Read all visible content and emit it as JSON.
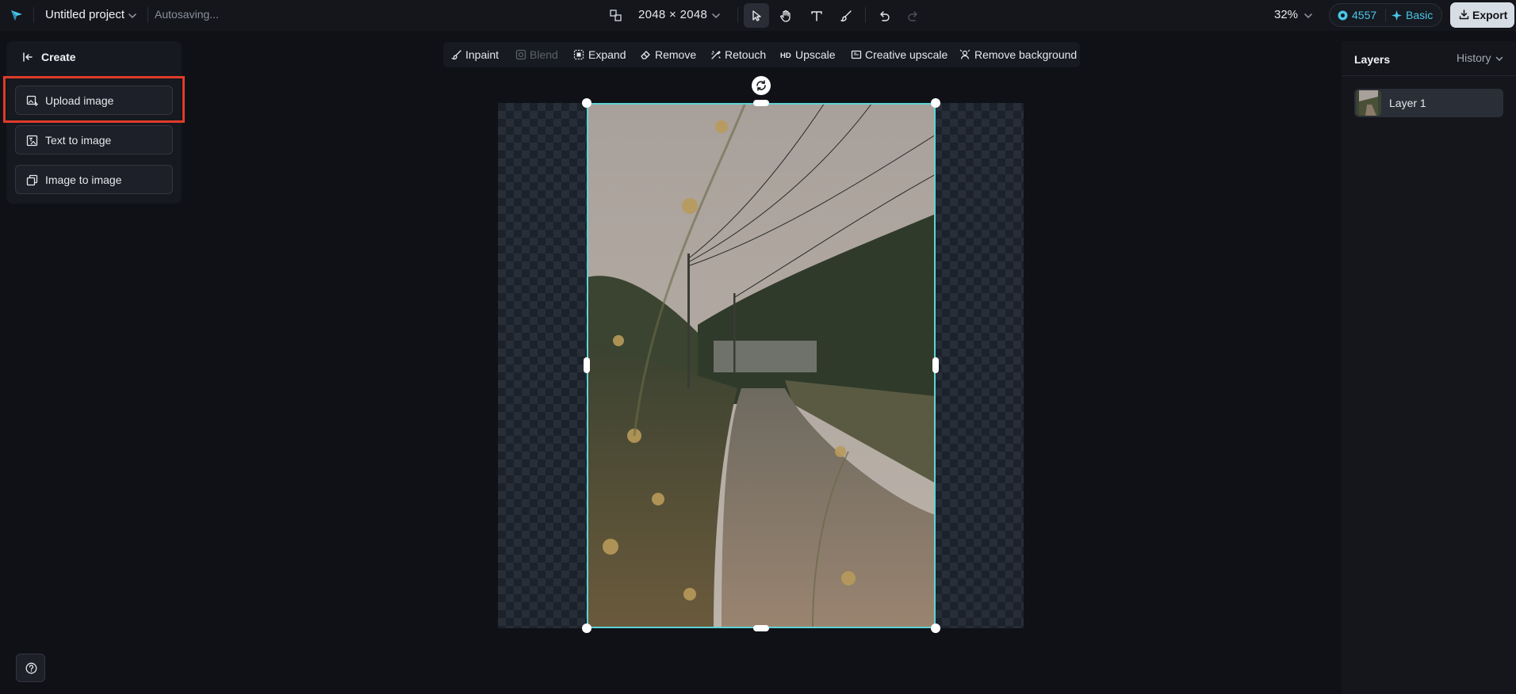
{
  "header": {
    "project_name": "Untitled project",
    "autosave_status": "Autosaving...",
    "canvas_size": "2048 × 2048",
    "zoom": "32%",
    "credits": "4557",
    "plan": "Basic",
    "export_label": "Export",
    "tools": [
      {
        "name": "select",
        "icon": "pointer-icon",
        "active": true
      },
      {
        "name": "hand",
        "icon": "hand-icon",
        "active": false
      },
      {
        "name": "text",
        "icon": "text-icon",
        "active": false
      },
      {
        "name": "brush",
        "icon": "brush-icon",
        "active": false
      },
      {
        "name": "undo",
        "icon": "undo-icon",
        "active": false
      },
      {
        "name": "redo",
        "icon": "redo-icon",
        "active": false,
        "disabled": true
      }
    ]
  },
  "edit_toolbar": {
    "items": [
      {
        "label": "Inpaint",
        "icon": "inpaint-icon",
        "disabled": false
      },
      {
        "label": "Blend",
        "icon": "blend-icon",
        "disabled": true
      },
      {
        "label": "Expand",
        "icon": "expand-icon",
        "disabled": false
      },
      {
        "label": "Remove",
        "icon": "eraser-icon",
        "disabled": false
      },
      {
        "label": "Retouch",
        "icon": "retouch-icon",
        "disabled": false
      },
      {
        "label": "Upscale",
        "icon": "hd-icon",
        "disabled": false
      },
      {
        "label": "Creative upscale",
        "icon": "creative-upscale-icon",
        "disabled": false
      },
      {
        "label": "Remove background",
        "icon": "remove-bg-icon",
        "disabled": false
      }
    ]
  },
  "create_panel": {
    "title": "Create",
    "items": [
      {
        "label": "Upload image",
        "icon": "upload-image-icon",
        "highlighted": true
      },
      {
        "label": "Text to image",
        "icon": "text-to-image-icon",
        "highlighted": false
      },
      {
        "label": "Image to image",
        "icon": "image-to-image-icon",
        "highlighted": false
      }
    ]
  },
  "layers_panel": {
    "title": "Layers",
    "history_label": "History",
    "layers": [
      {
        "name": "Layer 1",
        "selected": true
      }
    ]
  },
  "colors": {
    "accent": "#49c6e8",
    "selection": "#5fd3d6",
    "highlight": "#e03b2a",
    "background": "#0f1117"
  }
}
